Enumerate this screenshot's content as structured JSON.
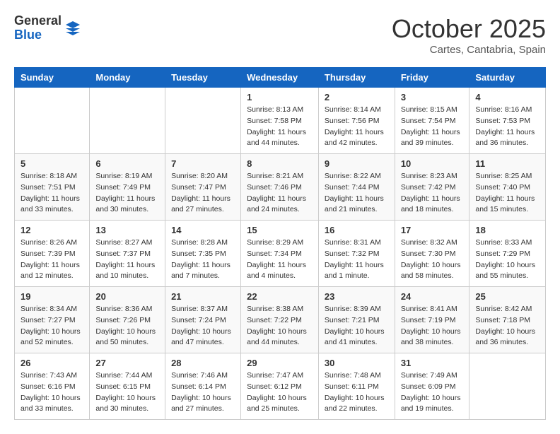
{
  "header": {
    "logo_general": "General",
    "logo_blue": "Blue",
    "month_title": "October 2025",
    "location": "Cartes, Cantabria, Spain"
  },
  "weekdays": [
    "Sunday",
    "Monday",
    "Tuesday",
    "Wednesday",
    "Thursday",
    "Friday",
    "Saturday"
  ],
  "weeks": [
    [
      {
        "day": "",
        "info": ""
      },
      {
        "day": "",
        "info": ""
      },
      {
        "day": "",
        "info": ""
      },
      {
        "day": "1",
        "info": "Sunrise: 8:13 AM\nSunset: 7:58 PM\nDaylight: 11 hours and 44 minutes."
      },
      {
        "day": "2",
        "info": "Sunrise: 8:14 AM\nSunset: 7:56 PM\nDaylight: 11 hours and 42 minutes."
      },
      {
        "day": "3",
        "info": "Sunrise: 8:15 AM\nSunset: 7:54 PM\nDaylight: 11 hours and 39 minutes."
      },
      {
        "day": "4",
        "info": "Sunrise: 8:16 AM\nSunset: 7:53 PM\nDaylight: 11 hours and 36 minutes."
      }
    ],
    [
      {
        "day": "5",
        "info": "Sunrise: 8:18 AM\nSunset: 7:51 PM\nDaylight: 11 hours and 33 minutes."
      },
      {
        "day": "6",
        "info": "Sunrise: 8:19 AM\nSunset: 7:49 PM\nDaylight: 11 hours and 30 minutes."
      },
      {
        "day": "7",
        "info": "Sunrise: 8:20 AM\nSunset: 7:47 PM\nDaylight: 11 hours and 27 minutes."
      },
      {
        "day": "8",
        "info": "Sunrise: 8:21 AM\nSunset: 7:46 PM\nDaylight: 11 hours and 24 minutes."
      },
      {
        "day": "9",
        "info": "Sunrise: 8:22 AM\nSunset: 7:44 PM\nDaylight: 11 hours and 21 minutes."
      },
      {
        "day": "10",
        "info": "Sunrise: 8:23 AM\nSunset: 7:42 PM\nDaylight: 11 hours and 18 minutes."
      },
      {
        "day": "11",
        "info": "Sunrise: 8:25 AM\nSunset: 7:40 PM\nDaylight: 11 hours and 15 minutes."
      }
    ],
    [
      {
        "day": "12",
        "info": "Sunrise: 8:26 AM\nSunset: 7:39 PM\nDaylight: 11 hours and 12 minutes."
      },
      {
        "day": "13",
        "info": "Sunrise: 8:27 AM\nSunset: 7:37 PM\nDaylight: 11 hours and 10 minutes."
      },
      {
        "day": "14",
        "info": "Sunrise: 8:28 AM\nSunset: 7:35 PM\nDaylight: 11 hours and 7 minutes."
      },
      {
        "day": "15",
        "info": "Sunrise: 8:29 AM\nSunset: 7:34 PM\nDaylight: 11 hours and 4 minutes."
      },
      {
        "day": "16",
        "info": "Sunrise: 8:31 AM\nSunset: 7:32 PM\nDaylight: 11 hours and 1 minute."
      },
      {
        "day": "17",
        "info": "Sunrise: 8:32 AM\nSunset: 7:30 PM\nDaylight: 10 hours and 58 minutes."
      },
      {
        "day": "18",
        "info": "Sunrise: 8:33 AM\nSunset: 7:29 PM\nDaylight: 10 hours and 55 minutes."
      }
    ],
    [
      {
        "day": "19",
        "info": "Sunrise: 8:34 AM\nSunset: 7:27 PM\nDaylight: 10 hours and 52 minutes."
      },
      {
        "day": "20",
        "info": "Sunrise: 8:36 AM\nSunset: 7:26 PM\nDaylight: 10 hours and 50 minutes."
      },
      {
        "day": "21",
        "info": "Sunrise: 8:37 AM\nSunset: 7:24 PM\nDaylight: 10 hours and 47 minutes."
      },
      {
        "day": "22",
        "info": "Sunrise: 8:38 AM\nSunset: 7:22 PM\nDaylight: 10 hours and 44 minutes."
      },
      {
        "day": "23",
        "info": "Sunrise: 8:39 AM\nSunset: 7:21 PM\nDaylight: 10 hours and 41 minutes."
      },
      {
        "day": "24",
        "info": "Sunrise: 8:41 AM\nSunset: 7:19 PM\nDaylight: 10 hours and 38 minutes."
      },
      {
        "day": "25",
        "info": "Sunrise: 8:42 AM\nSunset: 7:18 PM\nDaylight: 10 hours and 36 minutes."
      }
    ],
    [
      {
        "day": "26",
        "info": "Sunrise: 7:43 AM\nSunset: 6:16 PM\nDaylight: 10 hours and 33 minutes."
      },
      {
        "day": "27",
        "info": "Sunrise: 7:44 AM\nSunset: 6:15 PM\nDaylight: 10 hours and 30 minutes."
      },
      {
        "day": "28",
        "info": "Sunrise: 7:46 AM\nSunset: 6:14 PM\nDaylight: 10 hours and 27 minutes."
      },
      {
        "day": "29",
        "info": "Sunrise: 7:47 AM\nSunset: 6:12 PM\nDaylight: 10 hours and 25 minutes."
      },
      {
        "day": "30",
        "info": "Sunrise: 7:48 AM\nSunset: 6:11 PM\nDaylight: 10 hours and 22 minutes."
      },
      {
        "day": "31",
        "info": "Sunrise: 7:49 AM\nSunset: 6:09 PM\nDaylight: 10 hours and 19 minutes."
      },
      {
        "day": "",
        "info": ""
      }
    ]
  ]
}
